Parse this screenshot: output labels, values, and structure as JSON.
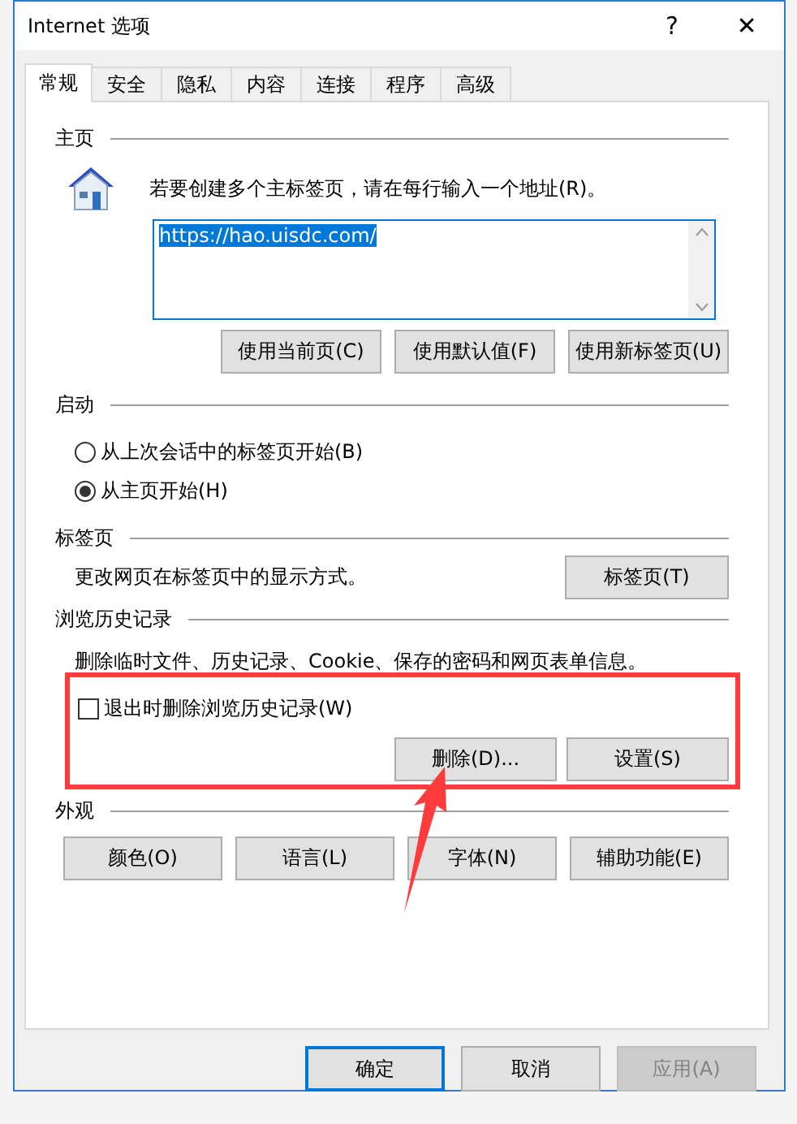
{
  "window": {
    "title": "Internet 选项",
    "help": "?",
    "close": "✕"
  },
  "tabs": [
    {
      "label": "常规",
      "selected": true
    },
    {
      "label": "安全",
      "selected": false
    },
    {
      "label": "隐私",
      "selected": false
    },
    {
      "label": "内容",
      "selected": false
    },
    {
      "label": "连接",
      "selected": false
    },
    {
      "label": "程序",
      "selected": false
    },
    {
      "label": "高级",
      "selected": false
    }
  ],
  "home": {
    "heading": "主页",
    "hint": "若要创建多个主标签页，请在每行输入一个地址(R)。",
    "value": "https://hao.uisdc.com/",
    "buttons": [
      "使用当前页(C)",
      "使用默认值(F)",
      "使用新标签页(U)"
    ]
  },
  "startup": {
    "heading": "启动",
    "options": [
      {
        "label": "从上次会话中的标签页开始(B)",
        "selected": false
      },
      {
        "label": "从主页开始(H)",
        "selected": true
      }
    ]
  },
  "tabs_section": {
    "heading": "标签页",
    "text": "更改网页在标签页中的显示方式。",
    "button": "标签页(T)"
  },
  "history": {
    "heading": "浏览历史记录",
    "text": "删除临时文件、历史记录、Cookie、保存的密码和网页表单信息。",
    "checkbox": {
      "label": "退出时删除浏览历史记录(W)",
      "checked": false
    },
    "buttons": [
      "删除(D)...",
      "设置(S)"
    ]
  },
  "appearance": {
    "heading": "外观",
    "buttons": [
      "颜色(O)",
      "语言(L)",
      "字体(N)",
      "辅助功能(E)"
    ]
  },
  "footer": [
    {
      "label": "确定",
      "kind": "default",
      "disabled": false
    },
    {
      "label": "取消",
      "kind": "normal",
      "disabled": false
    },
    {
      "label": "应用(A)",
      "kind": "normal",
      "disabled": true
    }
  ]
}
